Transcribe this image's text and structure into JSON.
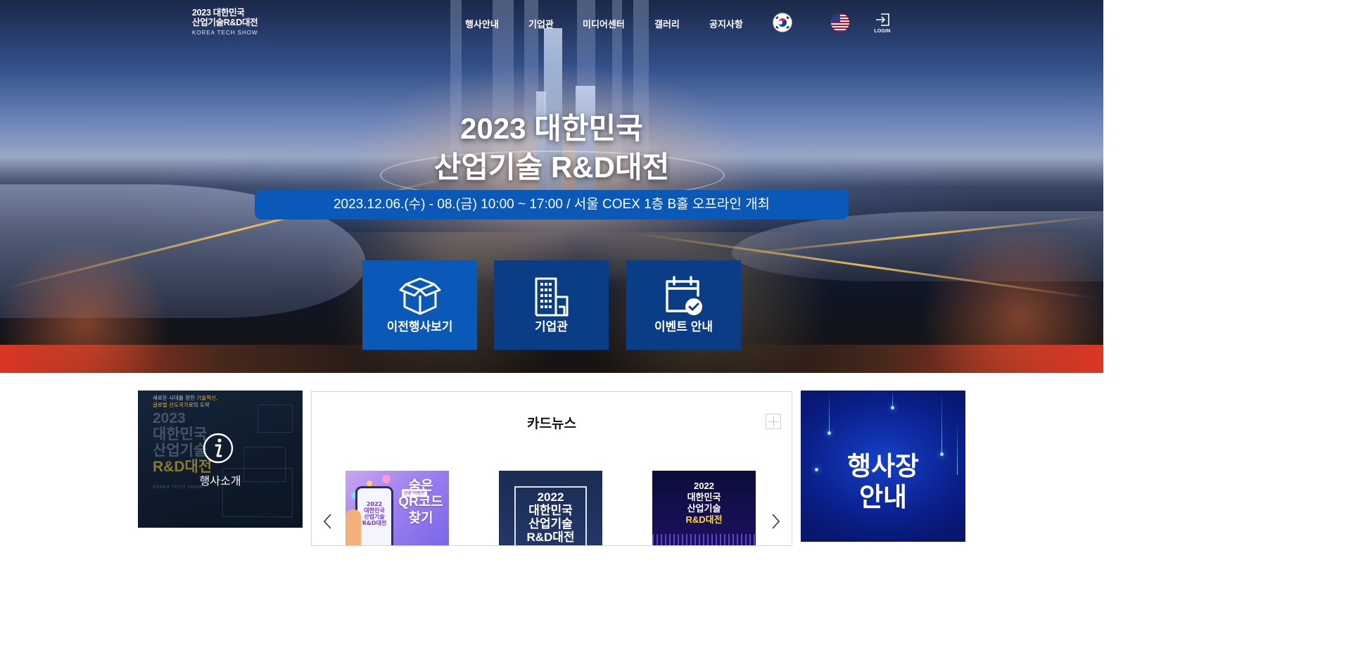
{
  "logo": {
    "line1": "2023 대한민국",
    "line2": "산업기술R&D대전",
    "line3": "KOREA TECH SHOW"
  },
  "nav": {
    "items": [
      "행사안내",
      "기업관",
      "미디어센터",
      "갤러리",
      "공지사항"
    ],
    "languages": [
      "korean-flag-icon",
      "us-flag-icon"
    ],
    "login_label": "LOGIN"
  },
  "hero": {
    "title_line1": "2023 대한민국",
    "title_line2": "산업기술 R&D대전",
    "date_text": "2023.12.06.(수) - 08.(금) 10:00 ~ 17:00 / 서울 COEX 1층 B홀 오프라인 개최",
    "quick_links": [
      {
        "label": "이전행사보기",
        "icon": "open-box-icon"
      },
      {
        "label": "기업관",
        "icon": "building-icon"
      },
      {
        "label": "이벤트 안내",
        "icon": "calendar-check-icon"
      }
    ]
  },
  "intro": {
    "small_line1_a": "새로운 시대를 향한 ",
    "small_line1_b": "기술혁신,",
    "small_line2_a": "글로벌 선도국가",
    "small_line2_b": "로의 도약",
    "big_line1": "2023",
    "big_line2": "대한민국",
    "big_line3": "산업기술",
    "big_line4": "R&D대전",
    "kts": "KOREA TECH SHOW",
    "label": "행사소개"
  },
  "cardnews": {
    "title": "카드뉴스",
    "cards": [
      {
        "badge": "현장 이벤트",
        "head_line1": "숨은",
        "head_line2": "QR코드",
        "head_line3": "찾기",
        "phone_line1": "2022",
        "phone_line2": "대한민국",
        "phone_line3": "산업기술",
        "phone_line4": "R&D대전"
      },
      {
        "line1": "2022",
        "line2": "대한민국",
        "line3": "산업기술",
        "line4": "R&D대전"
      },
      {
        "line1": "2022",
        "line2": "대한민국",
        "line3": "산업기술",
        "line4": "R&D대전"
      }
    ]
  },
  "venue": {
    "line1": "행사장",
    "line2": "안내"
  },
  "colors": {
    "primary_blue": "#0a58b8",
    "dark_blue": "#0a3d86",
    "venue_blue": "#0a1f8a"
  }
}
